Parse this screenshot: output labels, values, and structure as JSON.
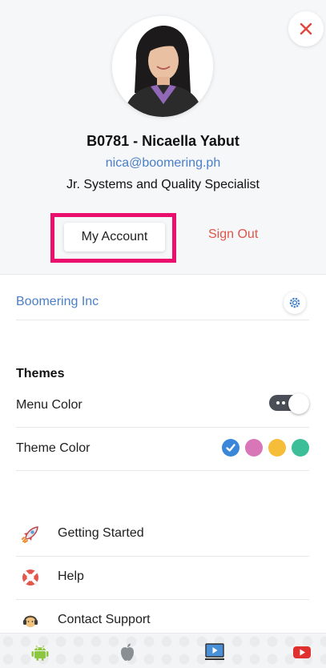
{
  "profile": {
    "name": "B0781 - Nicaella Yabut",
    "email": "nica@boomering.ph",
    "role": "Jr. Systems and Quality Specialist",
    "avatar_icon": "user-photo"
  },
  "actions": {
    "my_account_label": "My Account",
    "sign_out_label": "Sign Out",
    "close_icon": "close-icon"
  },
  "organization": {
    "name": "Boomering Inc",
    "settings_icon": "gear-icon"
  },
  "themes": {
    "title": "Themes",
    "menu_color_label": "Menu Color",
    "menu_color_dark": true,
    "theme_color_label": "Theme Color",
    "theme_colors": [
      "#3a86d8",
      "#d876b8",
      "#f5bd38",
      "#3cbf98"
    ],
    "selected_theme_color": "#3a86d8"
  },
  "nav": [
    {
      "label": "Getting Started",
      "icon": "rocket-icon"
    },
    {
      "label": "Help",
      "icon": "lifebuoy-icon"
    },
    {
      "label": "Contact Support",
      "icon": "headset-icon"
    }
  ],
  "footer": {
    "icons": [
      "android-icon",
      "apple-icon",
      "video-tutorial-icon",
      "youtube-icon"
    ]
  },
  "colors": {
    "accent_blue": "#4a7fc8",
    "sign_out_red": "#e05548",
    "highlight_pink": "#ea0f6c"
  }
}
